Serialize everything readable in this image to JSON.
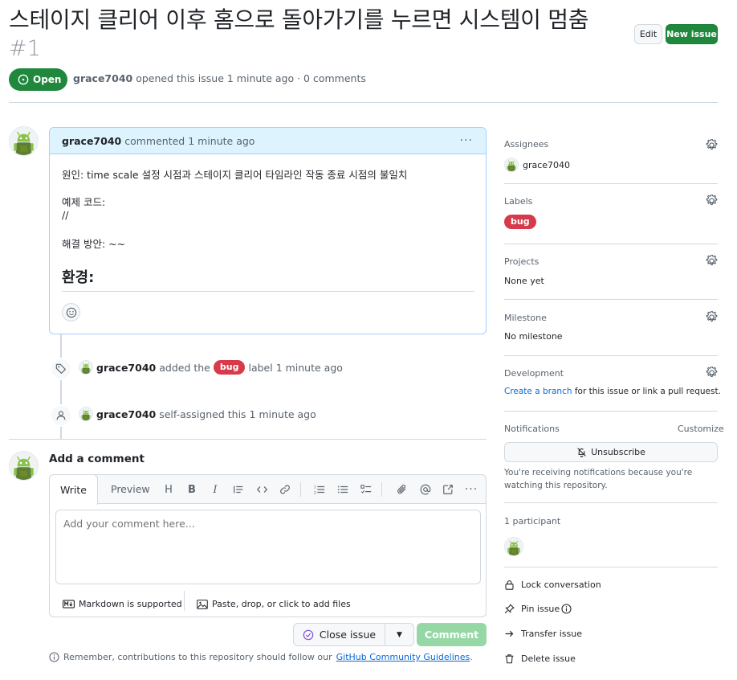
{
  "issue": {
    "title": "스테이지 클리어 이후 홈으로 돌아가기를 누르면 시스템이 멈춤",
    "number": "#1",
    "state": "Open",
    "author": "grace7040",
    "opened_text": "opened this issue 1 minute ago · 0 comments"
  },
  "header_buttons": {
    "edit": "Edit",
    "new_issue": "New issue"
  },
  "comment": {
    "author": "grace7040",
    "time": "commented 1 minute ago",
    "menu": "···",
    "line1": "원인: time scale 설정 시점과 스테이지 클리어 타임라인 작동 종료 시점의 불일치",
    "line2": "예제 코드:",
    "line3": "//",
    "line4": "해결 방안: ~~",
    "heading": "환경:"
  },
  "timeline": [
    {
      "author": "grace7040",
      "before": "added the",
      "label": "bug",
      "after": "label 1 minute ago"
    },
    {
      "author": "grace7040",
      "text": "self-assigned this 1 minute ago"
    }
  ],
  "composer": {
    "title": "Add a comment",
    "tab_write": "Write",
    "tab_preview": "Preview",
    "placeholder": "Add your comment here...",
    "markdown_note": "Markdown is supported",
    "attach_note": "Paste, drop, or click to add files",
    "close_issue": "Close issue",
    "comment_button": "Comment",
    "reminder_prefix": "Remember, contributions to this repository should follow our",
    "reminder_link": "GitHub Community Guidelines",
    "reminder_suffix": "."
  },
  "sidebar": {
    "assignees": {
      "label": "Assignees",
      "value": "grace7040"
    },
    "labels": {
      "label": "Labels",
      "value": "bug"
    },
    "projects": {
      "label": "Projects",
      "value": "None yet"
    },
    "milestone": {
      "label": "Milestone",
      "value": "No milestone"
    },
    "development": {
      "label": "Development",
      "link": "Create a branch",
      "rest": "for this issue or link a pull request."
    },
    "notifications": {
      "label": "Notifications",
      "customize": "Customize",
      "button": "Unsubscribe",
      "note": "You're receiving notifications because you're watching this repository."
    },
    "participants": {
      "label": "1 participant"
    },
    "actions": {
      "lock": "Lock conversation",
      "pin": "Pin issue",
      "transfer": "Transfer issue",
      "delete": "Delete issue"
    }
  },
  "colors": {
    "open_green": "#1f883d",
    "bug_red": "#d73a4a",
    "link_blue": "#0969da",
    "comment_header": "#ddf4ff"
  }
}
